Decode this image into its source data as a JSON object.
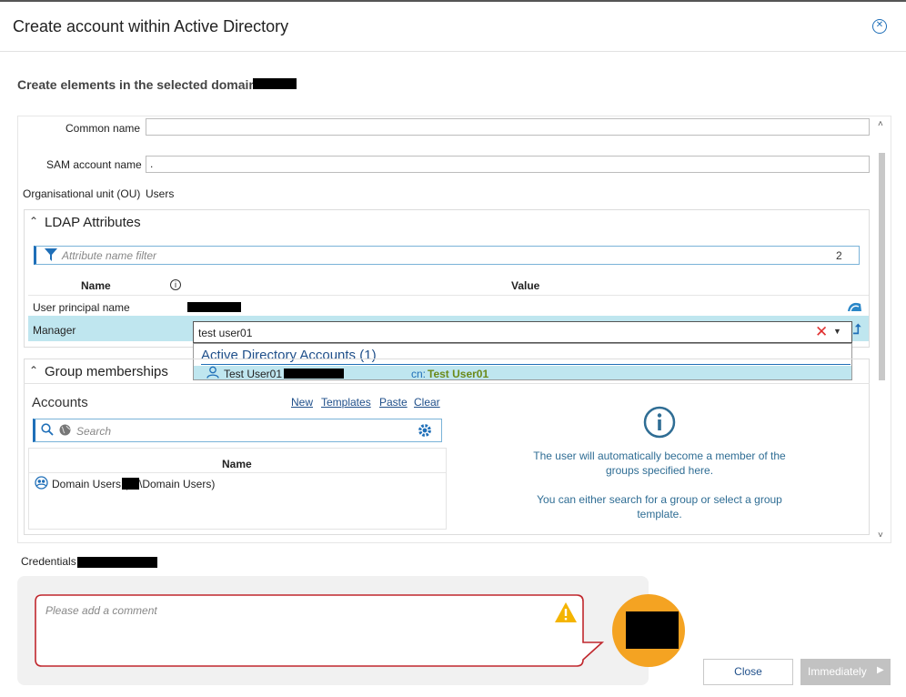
{
  "dialog": {
    "title": "Create account within Active Directory"
  },
  "subtitle": "Create elements in the selected domain:",
  "form": {
    "common_name_label": "Common name",
    "common_name_value": "",
    "sam_label": "SAM account name",
    "sam_value": ".",
    "ou_label": "Organisational unit (OU)",
    "ou_value": "Users"
  },
  "ldap": {
    "title": "LDAP Attributes",
    "filter_placeholder": "Attribute name filter",
    "filter_count": "2",
    "col_name": "Name",
    "col_value": "Value",
    "rows": [
      {
        "name": "User principal name"
      },
      {
        "name": "Manager",
        "value": "test user01"
      }
    ],
    "dropdown": {
      "group_title": "Active Directory Accounts (1)",
      "item_name": "Test User01",
      "item_cn_label": "cn:",
      "item_cn_value": "Test User01"
    }
  },
  "groups": {
    "title": "Group memberships",
    "accounts_label": "Accounts",
    "links": {
      "new": "New",
      "templates": "Templates",
      "paste": "Paste",
      "clear": "Clear"
    },
    "search_placeholder": "Search",
    "col_name": "Name",
    "items": [
      {
        "prefix": "Domain Users (",
        "suffix": "\\Domain Users)"
      }
    ],
    "info_line1": "The user will automatically become a member of the",
    "info_line2": "groups specified here.",
    "info_line3": "You can either search for a group or select a group",
    "info_line4": "template."
  },
  "credentials_label": "Credentials",
  "comment": {
    "placeholder": "Please add a comment"
  },
  "buttons": {
    "close": "Close",
    "immediately": "Immediately"
  },
  "colors": {
    "accent": "#1f6fb8",
    "selection": "#bfe6ef",
    "warning": "#f4a322",
    "comment_border": "#c0272d"
  }
}
